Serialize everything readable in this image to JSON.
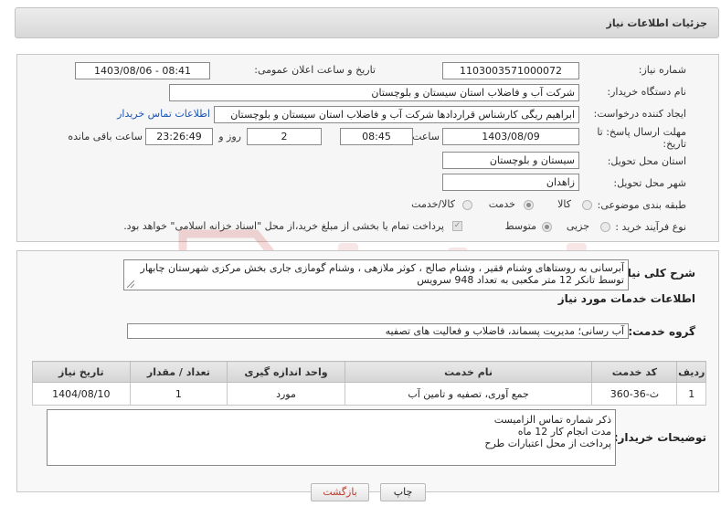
{
  "header": {
    "title": "جزئیات اطلاعات نیاز"
  },
  "form": {
    "need_number_label": "شماره نیاز:",
    "need_number": "1103003571000072",
    "announce_label": "تاریخ و ساعت اعلان عمومی:",
    "announce_value": "1403/08/06 - 08:41",
    "buyer_org_label": "نام دستگاه خریدار:",
    "buyer_org": "شرکت آب و فاضلاب استان سیستان و بلوچستان",
    "creator_label": "ایجاد کننده درخواست:",
    "creator": "ابراهیم ریگی کارشناس قراردادها شرکت آب و فاضلاب استان سیستان و بلوچستان",
    "contact_link": "اطلاعات تماس خریدار",
    "deadline_label_1": "مهلت ارسال پاسخ: تا",
    "deadline_label_2": "تاریخ:",
    "deadline_date": "1403/08/09",
    "time_label": "ساعت",
    "deadline_time": "08:45",
    "days_value": "2",
    "days_label": "روز و",
    "remaining_time": "23:26:49",
    "remaining_label": "ساعت باقی مانده",
    "province_label": "استان محل تحویل:",
    "province": "سیستان و بلوچستان",
    "city_label": "شهر محل تحویل:",
    "city": "زاهدان",
    "category_label": "طبقه بندی موضوعی:",
    "category_options": [
      "کالا",
      "خدمت",
      "کالا/خدمت"
    ],
    "process_label": "نوع فرآیند خرید :",
    "process_options": [
      "جزیی",
      "متوسط"
    ],
    "treasury_note": "پرداخت تمام یا بخشی از مبلغ خرید،از محل \"اسناد خزانه اسلامی\" خواهد بود."
  },
  "summary": {
    "label": "شرح کلی نیاز:",
    "text": "آبرسانی به روستاهای وشنام فقیر ، وشنام صالح ، کوثر ملازهی ، وشنام گومازی جاری بخش مرکزی شهرستان چابهار توسط تانکر 12 متر مکعبی به تعداد 948 سرویس"
  },
  "services": {
    "section_title": "اطلاعات خدمات مورد نیاز",
    "group_label": "گروه خدمت:",
    "group_value": "آب رسانی؛ مدیریت پسماند، فاضلاب و فعالیت های تصفیه",
    "columns": [
      "ردیف",
      "کد خدمت",
      "نام خدمت",
      "واحد اندازه گیری",
      "تعداد / مقدار",
      "تاریخ نیاز"
    ],
    "rows": [
      [
        "1",
        "ث-36-360",
        "جمع آوری، تصفیه و تامین آب",
        "مورد",
        "1",
        "1404/08/10"
      ]
    ]
  },
  "notes": {
    "label": "توضیحات خریدار:",
    "lines": [
      "ذکر شماره تماس الزامیست",
      "مدت انجام کار  12 ماه",
      "پرداخت از محل اعتبارات طرح"
    ]
  },
  "buttons": {
    "print": "چاپ",
    "back": "بازگشت"
  },
  "colors": {
    "link": "#1a56b8",
    "back_text": "#c0392b",
    "watermark": "#c9413b"
  }
}
